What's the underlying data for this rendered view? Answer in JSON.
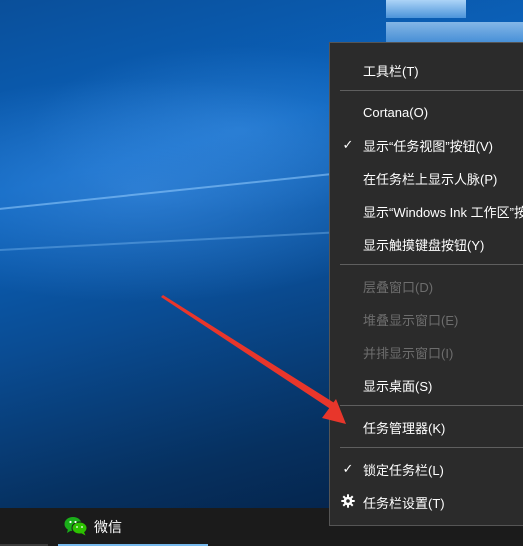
{
  "taskbar": {
    "app_label": "微信",
    "app_icon": "wechat-icon",
    "background": "#1b1b1b"
  },
  "menu": {
    "items": [
      {
        "label": "工具栏(T)",
        "enabled": true,
        "checked": false
      },
      {
        "label": "Cortana(O)",
        "enabled": true,
        "checked": false
      },
      {
        "label": "显示“任务视图”按钮(V)",
        "enabled": true,
        "checked": true
      },
      {
        "label": "在任务栏上显示人脉(P)",
        "enabled": true,
        "checked": false
      },
      {
        "label": "显示“Windows Ink 工作区”按",
        "enabled": true,
        "checked": false
      },
      {
        "label": "显示触摸键盘按钮(Y)",
        "enabled": true,
        "checked": false
      },
      {
        "label": "层叠窗口(D)",
        "enabled": false,
        "checked": false
      },
      {
        "label": "堆叠显示窗口(E)",
        "enabled": false,
        "checked": false
      },
      {
        "label": "并排显示窗口(I)",
        "enabled": false,
        "checked": false
      },
      {
        "label": "显示桌面(S)",
        "enabled": true,
        "checked": false
      },
      {
        "label": "任务管理器(K)",
        "enabled": true,
        "checked": false
      },
      {
        "label": "锁定任务栏(L)",
        "enabled": true,
        "checked": true
      },
      {
        "label": "任务栏设置(T)",
        "enabled": true,
        "checked": false,
        "icon": "gear-icon"
      }
    ],
    "check_glyph": "✓",
    "background": "#2b2b2b"
  },
  "annotation": {
    "arrow_color": "#e8362b"
  }
}
